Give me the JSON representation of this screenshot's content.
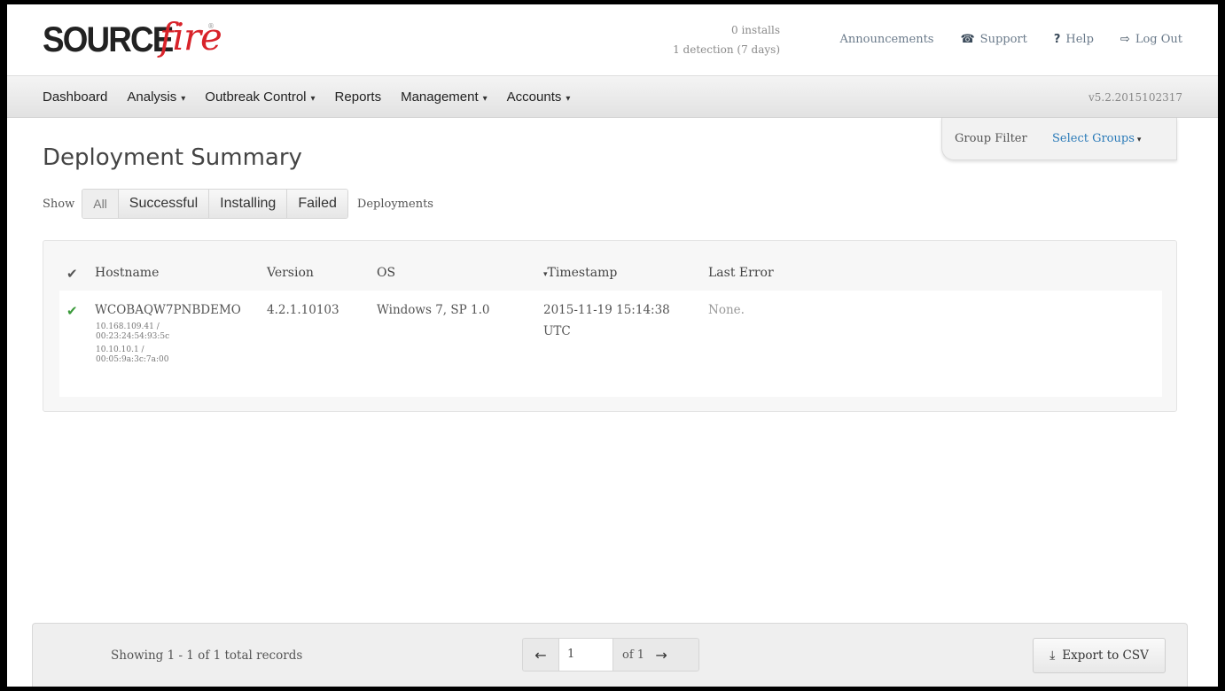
{
  "header": {
    "logo_text_bold": "SOURCE",
    "logo_text_script": "fire",
    "logo_reg": "®",
    "installs_line1": "0 installs",
    "installs_line2": "1 detection (7 days)",
    "links": {
      "announcements": "Announcements",
      "support": "Support",
      "help": "Help",
      "logout": "Log Out"
    },
    "icons": {
      "support": "☎",
      "help": "?",
      "logout": "⇨"
    }
  },
  "nav": {
    "items": [
      "Dashboard",
      "Analysis",
      "Outbreak Control",
      "Reports",
      "Management",
      "Accounts"
    ],
    "caret": "▾",
    "version": "v5.2.2015102317"
  },
  "group_filter": {
    "label": "Group Filter",
    "select": "Select Groups",
    "caret": "▾"
  },
  "page": {
    "title": "Deployment Summary"
  },
  "show": {
    "label": "Show",
    "buttons": [
      "All",
      "Successful",
      "Installing",
      "Failed"
    ],
    "suffix": "Deployments"
  },
  "table": {
    "check_icon": "✔",
    "sort_icon": "▾",
    "headers": {
      "hostname": "Hostname",
      "version": "Version",
      "os": "OS",
      "timestamp": "Timestamp",
      "last_error": "Last Error"
    },
    "rows": [
      {
        "hostname": "WCOBAQW7PNBDEMO",
        "ip1": "10.168.109.41 /",
        "mac1": "00:23:24:54:93:5c",
        "ip2": "10.10.10.1 /",
        "mac2": "00:05:9a:3c:7a:00",
        "version": "4.2.1.10103",
        "os": "Windows 7, SP 1.0",
        "timestamp_date": "2015-11-19  15:14:38",
        "timestamp_tz": "UTC",
        "last_error": "None."
      }
    ]
  },
  "footer": {
    "records": "Showing 1 - 1 of 1 total records",
    "prev_icon": "←",
    "next_icon": "→",
    "page_value": "1",
    "of_text": "of 1",
    "export_icon": "⤓",
    "export_label": "Export to CSV"
  },
  "colors": {
    "logo_red": "#d8232a",
    "link_blue": "#2a7ab8",
    "check_green": "#3a9a3a"
  }
}
